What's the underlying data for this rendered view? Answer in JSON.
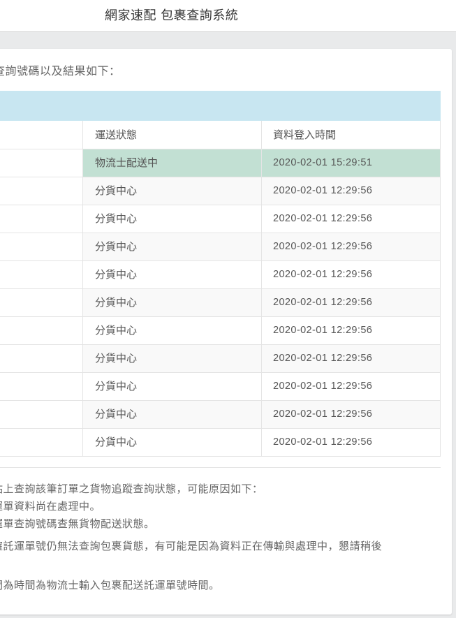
{
  "header": {
    "title": "網家速配 包裹查詢系統"
  },
  "intro_text": "查詢號碼以及結果如下：",
  "table": {
    "columns": [
      "運送狀態",
      "資料登入時間"
    ],
    "rows": [
      {
        "status": "物流士配送中",
        "time": "2020-02-01 15:29:51"
      },
      {
        "status": "分貨中心",
        "time": "2020-02-01 12:29:56"
      },
      {
        "status": "分貨中心",
        "time": "2020-02-01 12:29:56"
      },
      {
        "status": "分貨中心",
        "time": "2020-02-01 12:29:56"
      },
      {
        "status": "分貨中心",
        "time": "2020-02-01 12:29:56"
      },
      {
        "status": "分貨中心",
        "time": "2020-02-01 12:29:56"
      },
      {
        "status": "分貨中心",
        "time": "2020-02-01 12:29:56"
      },
      {
        "status": "分貨中心",
        "time": "2020-02-01 12:29:56"
      },
      {
        "status": "分貨中心",
        "time": "2020-02-01 12:29:56"
      },
      {
        "status": "分貨中心",
        "time": "2020-02-01 12:29:56"
      },
      {
        "status": "分貨中心",
        "time": "2020-02-01 12:29:56"
      }
    ]
  },
  "notes": [
    "站上查詢該筆訂單之貨物追蹤查詢狀態，可能原因如下：",
    "運單資料尚在處理中。",
    "運單查詢號碼查無貨物配送狀態。",
    "確託運單號仍無法查詢包裹貨態，有可能是因為資料正在傳輸與處理中，懇請稍後",
    "間為時間為物流士輸入包裹配送託運單號時間。"
  ],
  "colors": {
    "header_band": "#c8e6f1",
    "active_row": "#c2e0d3",
    "background": "#e9eaeb"
  }
}
